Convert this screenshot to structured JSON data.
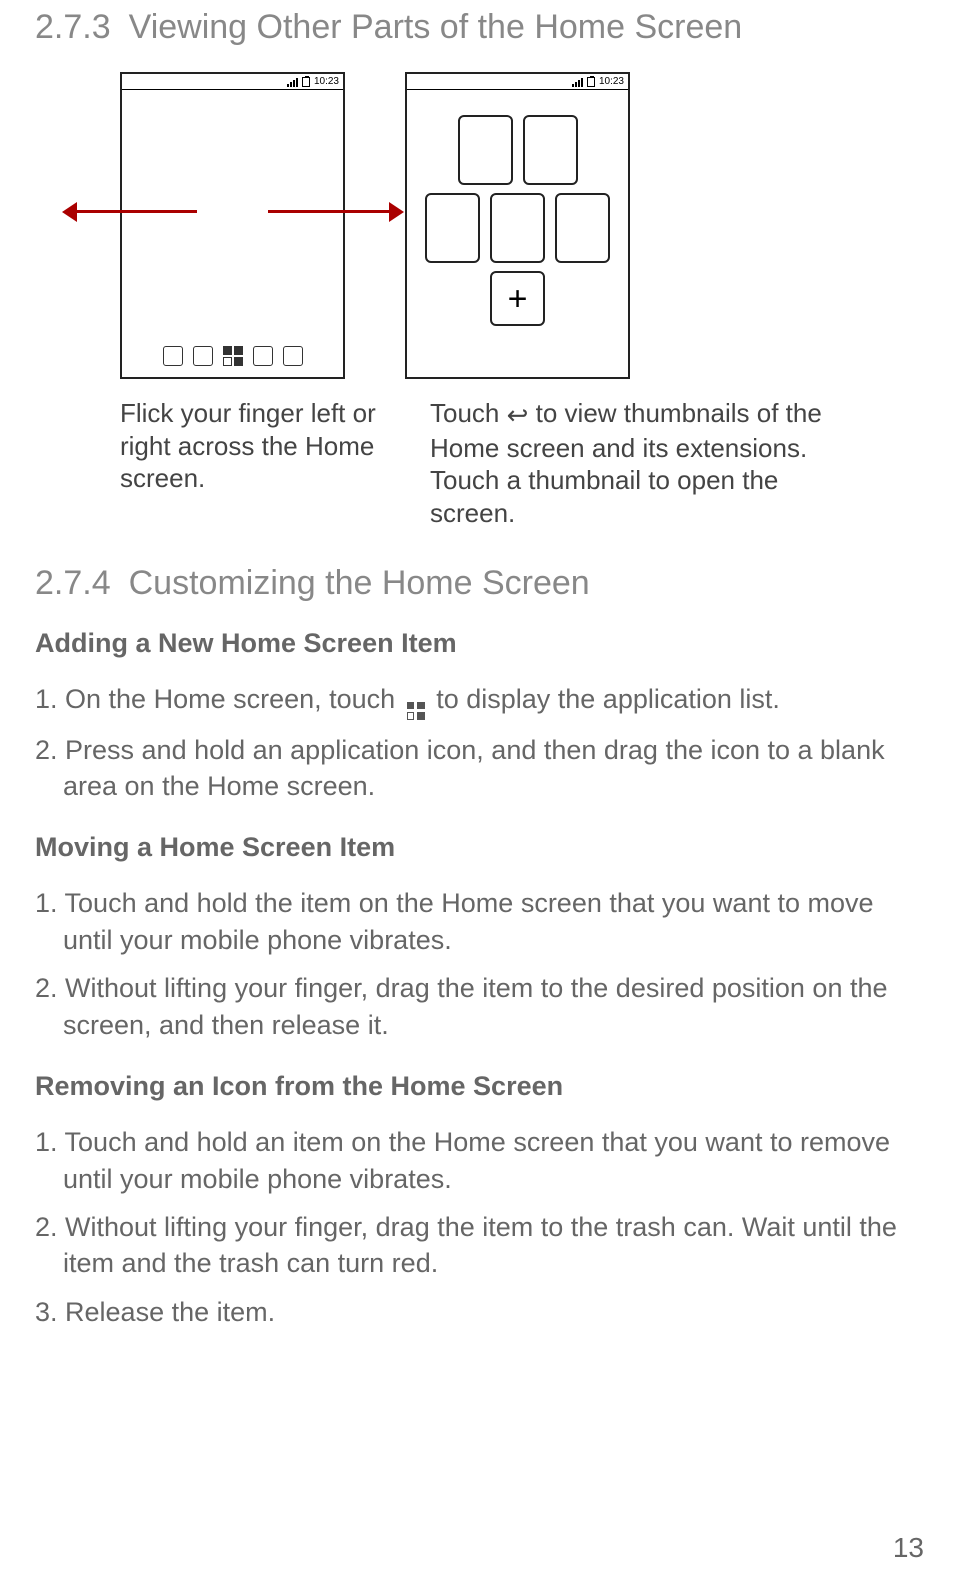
{
  "section273": {
    "num": "2.7.3",
    "title": "Viewing Other Parts of the Home Screen"
  },
  "section274": {
    "num": "2.7.4",
    "title": "Customizing the Home Screen"
  },
  "status": {
    "time": "10:23"
  },
  "plus_glyph": "+",
  "captions": {
    "left": "Flick your finger left or right across the Home screen.",
    "right_pre": "Touch ",
    "right_post": " to view thumbnails of the Home screen and its extensions. Touch a thumbnail to open the screen.",
    "back_glyph": "↩"
  },
  "adding": {
    "heading": "Adding a New Home Screen Item",
    "step1_pre": "1. On the Home screen, touch ",
    "step1_post": " to display the application list.",
    "step2": "2. Press and hold an application icon, and then drag the icon to a blank area on the Home screen."
  },
  "moving": {
    "heading": "Moving a Home Screen Item",
    "step1": "1. Touch and hold the item on the Home screen that you want to move until your mobile phone vibrates.",
    "step2": "2. Without lifting your finger, drag the item to the desired position on the screen, and then release it."
  },
  "removing": {
    "heading": "Removing an Icon from the Home Screen",
    "step1": "1. Touch and hold an item on the Home screen that you want to remove until your mobile phone vibrates.",
    "step2": "2. Without lifting your finger, drag the item to the trash can. Wait until the item and the trash can turn red.",
    "step3": "3. Release the item."
  },
  "page_number": "13"
}
